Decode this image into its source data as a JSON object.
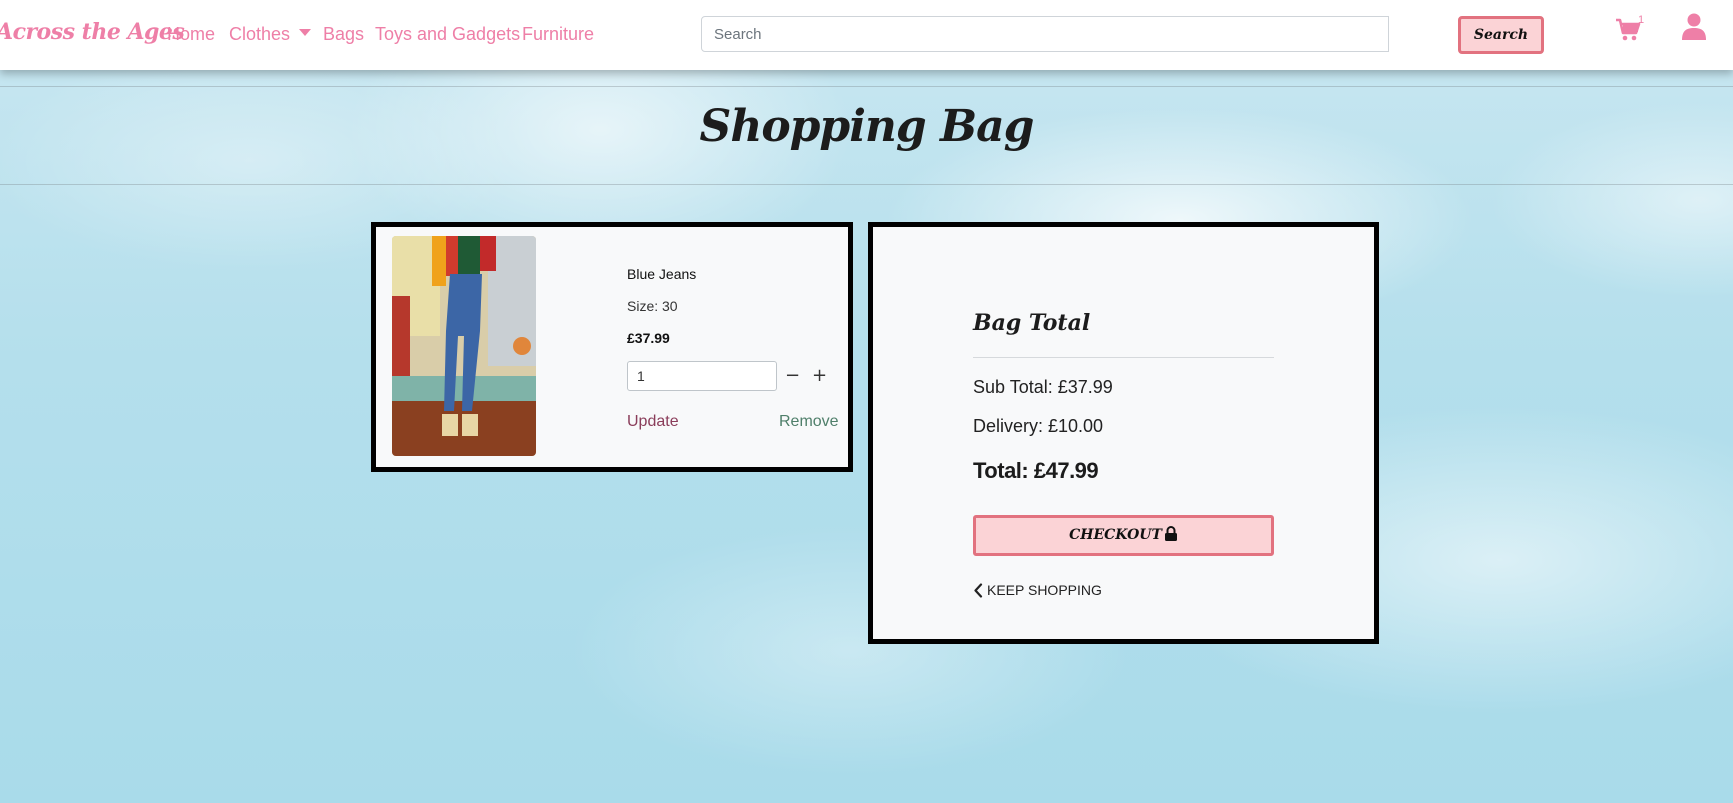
{
  "navbar": {
    "brand": "Across the Ages",
    "links": [
      {
        "label": "Home"
      },
      {
        "label": "Clothes"
      },
      {
        "label": "Bags"
      },
      {
        "label": "Toys and Gadgets"
      },
      {
        "label": "Furniture"
      }
    ],
    "search_placeholder": "Search",
    "search_button": "Search",
    "cart_count": "1",
    "cart_icon": "shopping-cart-icon",
    "user_icon": "user-icon"
  },
  "page": {
    "title": "Shopping Bag"
  },
  "bag_item": {
    "image_icon": "product-photo",
    "name": "Blue Jeans",
    "size": "Size: 30",
    "price": "£37.99",
    "quantity": "1",
    "decrement": "−",
    "increment": "+",
    "update": "Update",
    "remove": "Remove"
  },
  "summary": {
    "heading": "Bag Total",
    "subtotal": "Sub Total: £37.99",
    "delivery": "Delivery: £10.00",
    "total": "Total: £47.99",
    "checkout": "CHECKOUT",
    "keep_shopping": "KEEP SHOPPING"
  },
  "colors": {
    "brand_pink": "#ee7fa7",
    "button_fill": "#fbd3d6",
    "button_border": "#e2727f",
    "card_bg": "#f8f9fa",
    "update_link": "#8a3d5a",
    "remove_link": "#4f7f6a"
  }
}
